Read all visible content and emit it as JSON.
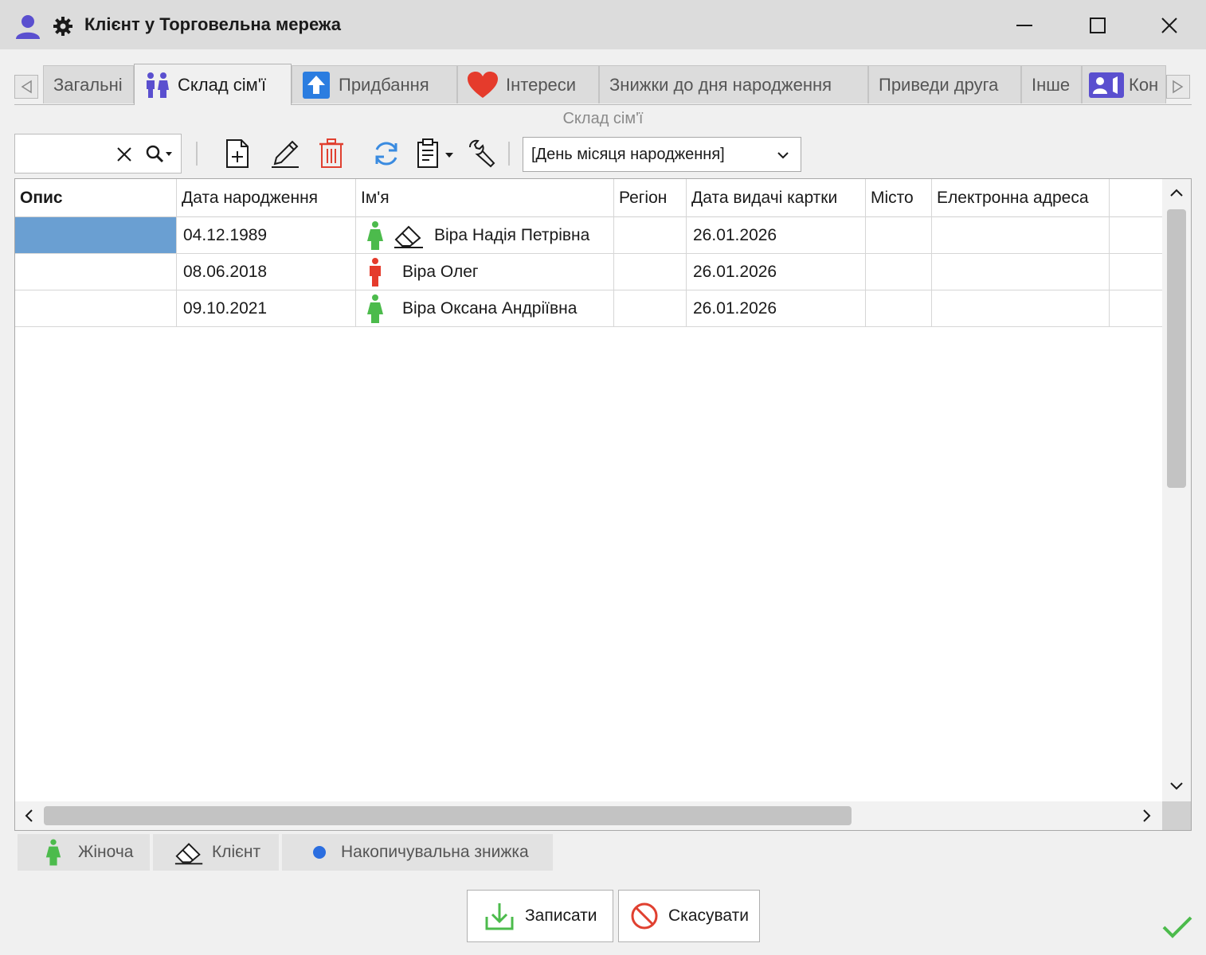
{
  "window": {
    "title": "Клієнт у Торговельна мережа",
    "icons": [
      "user-icon",
      "gear-icon"
    ],
    "controls": [
      "minimize",
      "maximize",
      "close"
    ]
  },
  "tabs": [
    {
      "label": "Загальні",
      "icon": null,
      "active": false
    },
    {
      "label": "Склад сім'ї",
      "icon": "family-icon",
      "active": true
    },
    {
      "label": "Придбання",
      "icon": "upload-arrow-icon",
      "active": false
    },
    {
      "label": "Інтереси",
      "icon": "heart-icon",
      "active": false
    },
    {
      "label": "Знижки до дня народження",
      "icon": null,
      "active": false
    },
    {
      "label": "Приведи друга",
      "icon": null,
      "active": false
    },
    {
      "label": "Інше",
      "icon": null,
      "active": false
    },
    {
      "label": "Кон",
      "icon": "contacts-icon",
      "active": false
    }
  ],
  "section_caption": "Склад сім'ї",
  "toolbar": {
    "search_value": "",
    "filter_selected": "[День місяця народження]"
  },
  "grid": {
    "columns": [
      "Опис",
      "Дата народження",
      "Ім'я",
      "Регіон",
      "Дата видачі картки",
      "Місто",
      "Електронна адреса"
    ],
    "rows": [
      {
        "opys": "",
        "birth_date": "04.12.1989",
        "gender": "female",
        "is_client": true,
        "name": "Віра Надія Петрівна",
        "region": "",
        "card_date": "26.01.2026",
        "city": "",
        "email": "",
        "selected": true
      },
      {
        "opys": "",
        "birth_date": "08.06.2018",
        "gender": "male",
        "is_client": false,
        "name": "Віра Олег",
        "region": "",
        "card_date": "26.01.2026",
        "city": "",
        "email": "",
        "selected": false
      },
      {
        "opys": "",
        "birth_date": "09.10.2021",
        "gender": "female",
        "is_client": false,
        "name": "Віра Оксана Андріївна",
        "region": "",
        "card_date": "26.01.2026",
        "city": "",
        "email": "",
        "selected": false
      }
    ]
  },
  "legend": [
    {
      "label": "Жіноча",
      "icon": "female-figure-icon"
    },
    {
      "label": "Клієнт",
      "icon": "eraser-icon"
    },
    {
      "label": "Накопичувальна знижка",
      "icon": "blue-dot-icon"
    }
  ],
  "buttons": {
    "save": "Записати",
    "cancel": "Скасувати"
  },
  "colors": {
    "female": "#4cbb4c",
    "male": "#e53b2c",
    "selection": "#6a9fd2",
    "accent_blue": "#3a7bd5",
    "delete_red": "#e04030",
    "ok_green": "#4cbb4c"
  }
}
